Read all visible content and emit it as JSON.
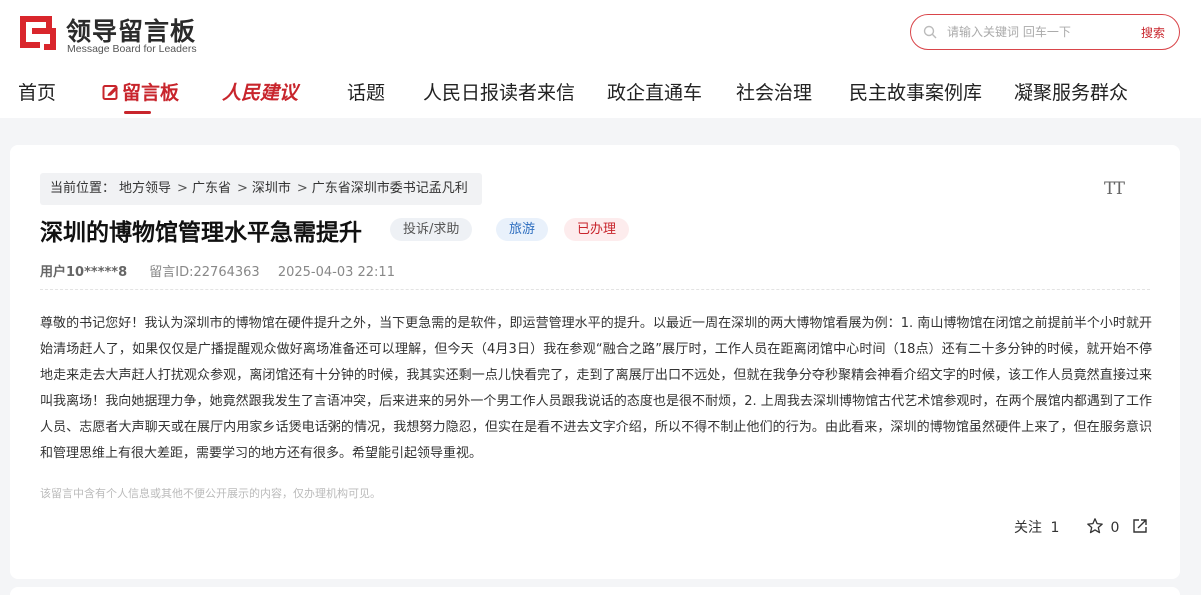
{
  "header": {
    "logo_title": "领导留言板",
    "logo_subtitle": "Message Board for Leaders",
    "search_placeholder": "请输入关键词 回车一下",
    "search_button": "搜索",
    "brand_color": "#c8252c"
  },
  "nav": {
    "items": [
      {
        "label": "首页",
        "active": false
      },
      {
        "label": "留言板",
        "active": true
      },
      {
        "label": "人民建议",
        "active": false
      },
      {
        "label": "话题",
        "active": false
      },
      {
        "label": "人民日报读者来信",
        "active": false
      },
      {
        "label": "政企直通车",
        "active": false
      },
      {
        "label": "社会治理",
        "active": false
      },
      {
        "label": "民主故事案例库",
        "active": false
      },
      {
        "label": "凝聚服务群众",
        "active": false
      }
    ]
  },
  "breadcrumb": {
    "prefix": "当前位置：",
    "items": [
      "地方领导",
      "广东省",
      "深圳市",
      "广东省深圳市委书记孟凡利"
    ],
    "separator": ">"
  },
  "message": {
    "title": "深圳的博物馆管理水平急需提升",
    "tags": [
      "投诉/求助",
      "旅游",
      "已办理"
    ],
    "user": "用户10*****8",
    "message_id": "留言ID:22764363",
    "datetime": "2025-04-03 22:11",
    "body": "尊敬的书记您好！我认为深圳市的博物馆在硬件提升之外，当下更急需的是软件，即运营管理水平的提升。以最近一周在深圳的两大博物馆看展为例：1. 南山博物馆在闭馆之前提前半个小时就开始清场赶人了，如果仅仅是广播提醒观众做好离场准备还可以理解，但今天（4月3日）我在参观“融合之路”展厅时，工作人员在距离闭馆中心时间（18点）还有二十多分钟的时候，就开始不停地走来走去大声赶人打扰观众参观，离闭馆还有十分钟的时候，我其实还剩一点儿快看完了，走到了离展厅出口不远处，但就在我争分夺秒聚精会神看介绍文字的时候，该工作人员竟然直接过来叫我离场！我向她据理力争，她竟然跟我发生了言语冲突，后来进来的另外一个男工作人员跟我说话的态度也是很不耐烦，2. 上周我去深圳博物馆古代艺术馆参观时，在两个展馆内都遇到了工作人员、志愿者大声聊天或在展厅内用家乡话煲电话粥的情况，我想努力隐忍，但实在是看不进去文字介绍，所以不得不制止他们的行为。由此看来，深圳的博物馆虽然硬件上来了，但在服务意识和管理思维上有很大差距，需要学习的地方还有很多。希望能引起领导重视。",
    "notice": "该留言中含有个人信息或其他不便公开展示的内容，仅办理机构可见。",
    "follow_label": "关注",
    "follow_count": "1",
    "like_count": "0"
  },
  "icons": {
    "search": "search-icon",
    "font_size": "font-size-icon",
    "like": "star-icon",
    "share": "share-icon",
    "font_size_glyph": "TT"
  }
}
